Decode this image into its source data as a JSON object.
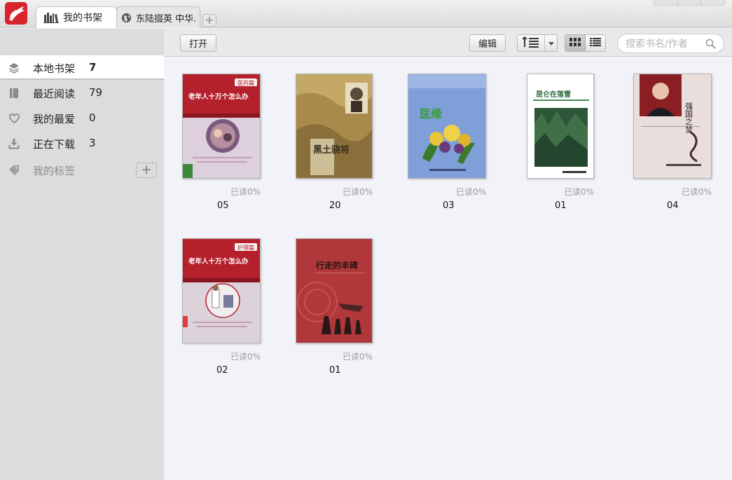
{
  "tabs": [
    {
      "label": "我的书架",
      "icon": "bookshelf-icon",
      "active": true
    },
    {
      "label": "东陆掇英  中华.",
      "icon": "globe-icon",
      "active": false
    }
  ],
  "sidebar": {
    "items": [
      {
        "label": "本地书架",
        "count": "7",
        "icon": "layers-icon",
        "active": true
      },
      {
        "label": "最近阅读",
        "count": "79",
        "icon": "book-icon"
      },
      {
        "label": "我的最爱",
        "count": "0",
        "icon": "heart-icon"
      },
      {
        "label": "正在下载",
        "count": "3",
        "icon": "download-icon"
      },
      {
        "label": "我的标签",
        "icon": "tag-icon",
        "add_label": "+"
      }
    ]
  },
  "toolbar": {
    "open_label": "打开",
    "edit_label": "编辑",
    "search_placeholder": "搜索书名/作者"
  },
  "books": [
    {
      "title": "05",
      "progress": "已读0%",
      "cover": {
        "caption": "老年人十万个怎么办",
        "badge": "医药篇",
        "palette": [
          "#b5202c",
          "#dccdd9"
        ]
      }
    },
    {
      "title": "20",
      "progress": "已读0%",
      "cover": {
        "caption": "黑土骁将",
        "palette": [
          "#b79a58",
          "#e2d39e"
        ]
      }
    },
    {
      "title": "03",
      "progress": "已读0%",
      "cover": {
        "caption": "医缘",
        "palette": [
          "#7f9fd9",
          "#e5c43a"
        ]
      }
    },
    {
      "title": "01",
      "progress": "已读0%",
      "cover": {
        "caption": "昆仑在落雪",
        "palette": [
          "#2d5638",
          "#ffffff"
        ]
      }
    },
    {
      "title": "04",
      "progress": "已读0%",
      "cover": {
        "caption": "强国之梦",
        "palette": [
          "#eadfdc",
          "#8a2020"
        ]
      }
    },
    {
      "title": "02",
      "progress": "已读0%",
      "cover": {
        "caption": "老年人十万个怎么办",
        "badge": "护理篇",
        "palette": [
          "#b5202c",
          "#dcd3da"
        ]
      }
    },
    {
      "title": "01",
      "progress": "已读0%",
      "cover": {
        "caption": "行走的丰碑",
        "palette": [
          "#b0373a",
          "#2a1818"
        ]
      }
    }
  ],
  "colors": {
    "brand": "#d8232a",
    "page_bg": "#f2f3f8",
    "sidebar_bg": "#dcdcdc"
  }
}
